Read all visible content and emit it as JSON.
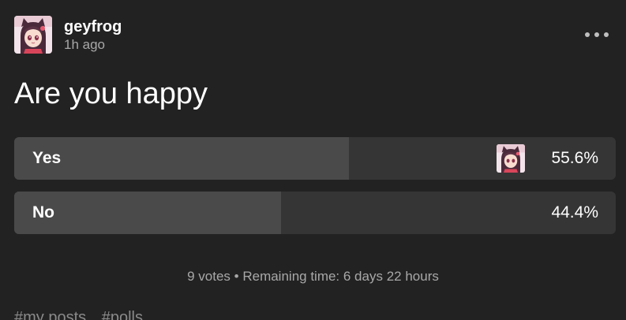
{
  "post": {
    "author": "geyfrog",
    "time_ago": "1h ago",
    "avatar_icon": "anime-girl-avatar"
  },
  "poll": {
    "question": "Are you happy",
    "options": [
      {
        "label": "Yes",
        "percent_text": "55.6%",
        "percent": 55.6,
        "voted_by_avatar": true
      },
      {
        "label": "No",
        "percent_text": "44.4%",
        "percent": 44.4,
        "voted_by_avatar": false
      }
    ],
    "footer": "9 votes • Remaining time: 6 days 22 hours"
  },
  "tags": [
    "#my posts",
    "#polls"
  ],
  "colors": {
    "background": "#222222",
    "bar_track": "#353535",
    "bar_fill": "#4a4a4a",
    "muted_text": "#a8a8a8"
  }
}
